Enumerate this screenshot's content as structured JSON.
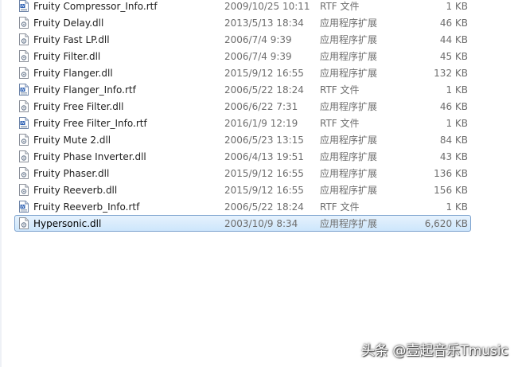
{
  "files": [
    {
      "name": "Fruity Compressor_Info.rtf",
      "date": "2009/10/25 10:11",
      "type": "RTF 文件",
      "size": "1 KB",
      "icon": "rtf-document-icon"
    },
    {
      "name": "Fruity Delay.dll",
      "date": "2013/5/13 18:34",
      "type": "应用程序扩展",
      "size": "46 KB",
      "icon": "dll-file-icon"
    },
    {
      "name": "Fruity Fast LP.dll",
      "date": "2006/7/4 9:39",
      "type": "应用程序扩展",
      "size": "44 KB",
      "icon": "dll-file-icon"
    },
    {
      "name": "Fruity Filter.dll",
      "date": "2006/7/4 9:39",
      "type": "应用程序扩展",
      "size": "45 KB",
      "icon": "dll-file-icon"
    },
    {
      "name": "Fruity Flanger.dll",
      "date": "2015/9/12 16:55",
      "type": "应用程序扩展",
      "size": "132 KB",
      "icon": "dll-file-icon"
    },
    {
      "name": "Fruity Flanger_Info.rtf",
      "date": "2006/5/22 18:24",
      "type": "RTF 文件",
      "size": "1 KB",
      "icon": "rtf-document-icon"
    },
    {
      "name": "Fruity Free Filter.dll",
      "date": "2006/6/22 7:31",
      "type": "应用程序扩展",
      "size": "46 KB",
      "icon": "dll-file-icon"
    },
    {
      "name": "Fruity Free Filter_Info.rtf",
      "date": "2016/1/9 12:19",
      "type": "RTF 文件",
      "size": "1 KB",
      "icon": "rtf-document-icon"
    },
    {
      "name": "Fruity Mute 2.dll",
      "date": "2006/5/23 13:15",
      "type": "应用程序扩展",
      "size": "84 KB",
      "icon": "dll-file-icon"
    },
    {
      "name": "Fruity Phase Inverter.dll",
      "date": "2006/4/13 19:51",
      "type": "应用程序扩展",
      "size": "43 KB",
      "icon": "dll-file-icon"
    },
    {
      "name": "Fruity Phaser.dll",
      "date": "2015/9/12 16:55",
      "type": "应用程序扩展",
      "size": "136 KB",
      "icon": "dll-file-icon"
    },
    {
      "name": "Fruity Reeverb.dll",
      "date": "2015/9/12 16:55",
      "type": "应用程序扩展",
      "size": "156 KB",
      "icon": "dll-file-icon"
    },
    {
      "name": "Fruity Reeverb_Info.rtf",
      "date": "2006/5/22 18:24",
      "type": "RTF 文件",
      "size": "1 KB",
      "icon": "rtf-document-icon"
    },
    {
      "name": "Hypersonic.dll",
      "date": "2003/10/9 8:34",
      "type": "应用程序扩展",
      "size": "6,620 KB",
      "icon": "dll-file-icon",
      "selected": true
    }
  ],
  "watermark": "头条 @壹起音乐Tmusic",
  "colors": {
    "selection_fill": "#cde6fc",
    "selection_border": "#7da2ce",
    "secondary_text": "#6d6d6d"
  }
}
